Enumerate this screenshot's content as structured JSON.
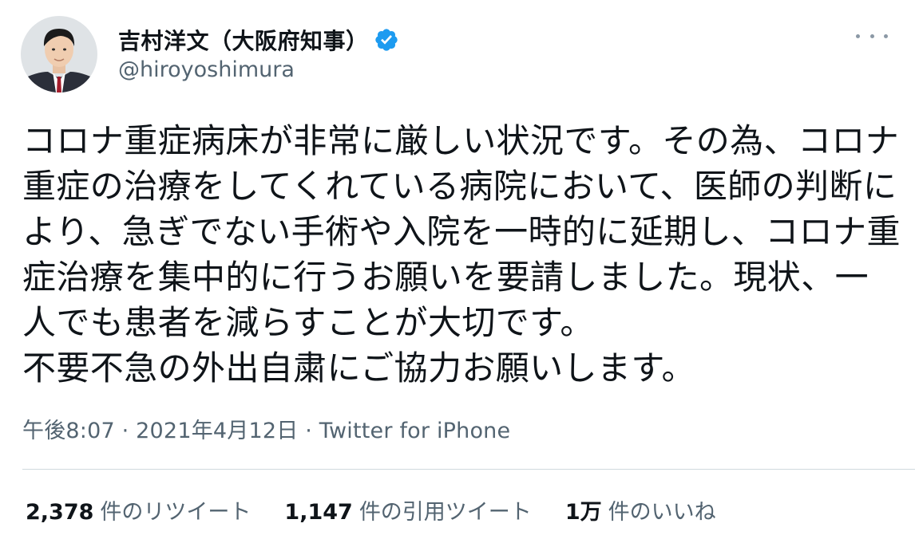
{
  "author": {
    "display_name": "吉村洋文（大阪府知事）",
    "handle": "@hiroyoshimura",
    "verified": true,
    "verified_color": "#1d9bf0"
  },
  "tweet": {
    "text": "コロナ重症病床が非常に厳しい状況です。その為、コロナ重症の治療をしてくれている病院において、医師の判断により、急ぎでない手術や入院を一時的に延期し、コロナ重症治療を集中的に行うお願いを要請しました。現状、一人でも患者を減らすことが大切です。\n不要不急の外出自粛にご協力お願いします。",
    "meta": "午後8:07 · 2021年4月12日 · Twitter for iPhone"
  },
  "stats": [
    {
      "value": "2,378",
      "label": "件のリツイート"
    },
    {
      "value": "1,147",
      "label": "件の引用ツイート"
    },
    {
      "value": "1万",
      "label": "件のいいね"
    }
  ],
  "icons": {
    "more": "more-options-icon",
    "verified": "verified-badge-icon",
    "avatar": "avatar"
  }
}
